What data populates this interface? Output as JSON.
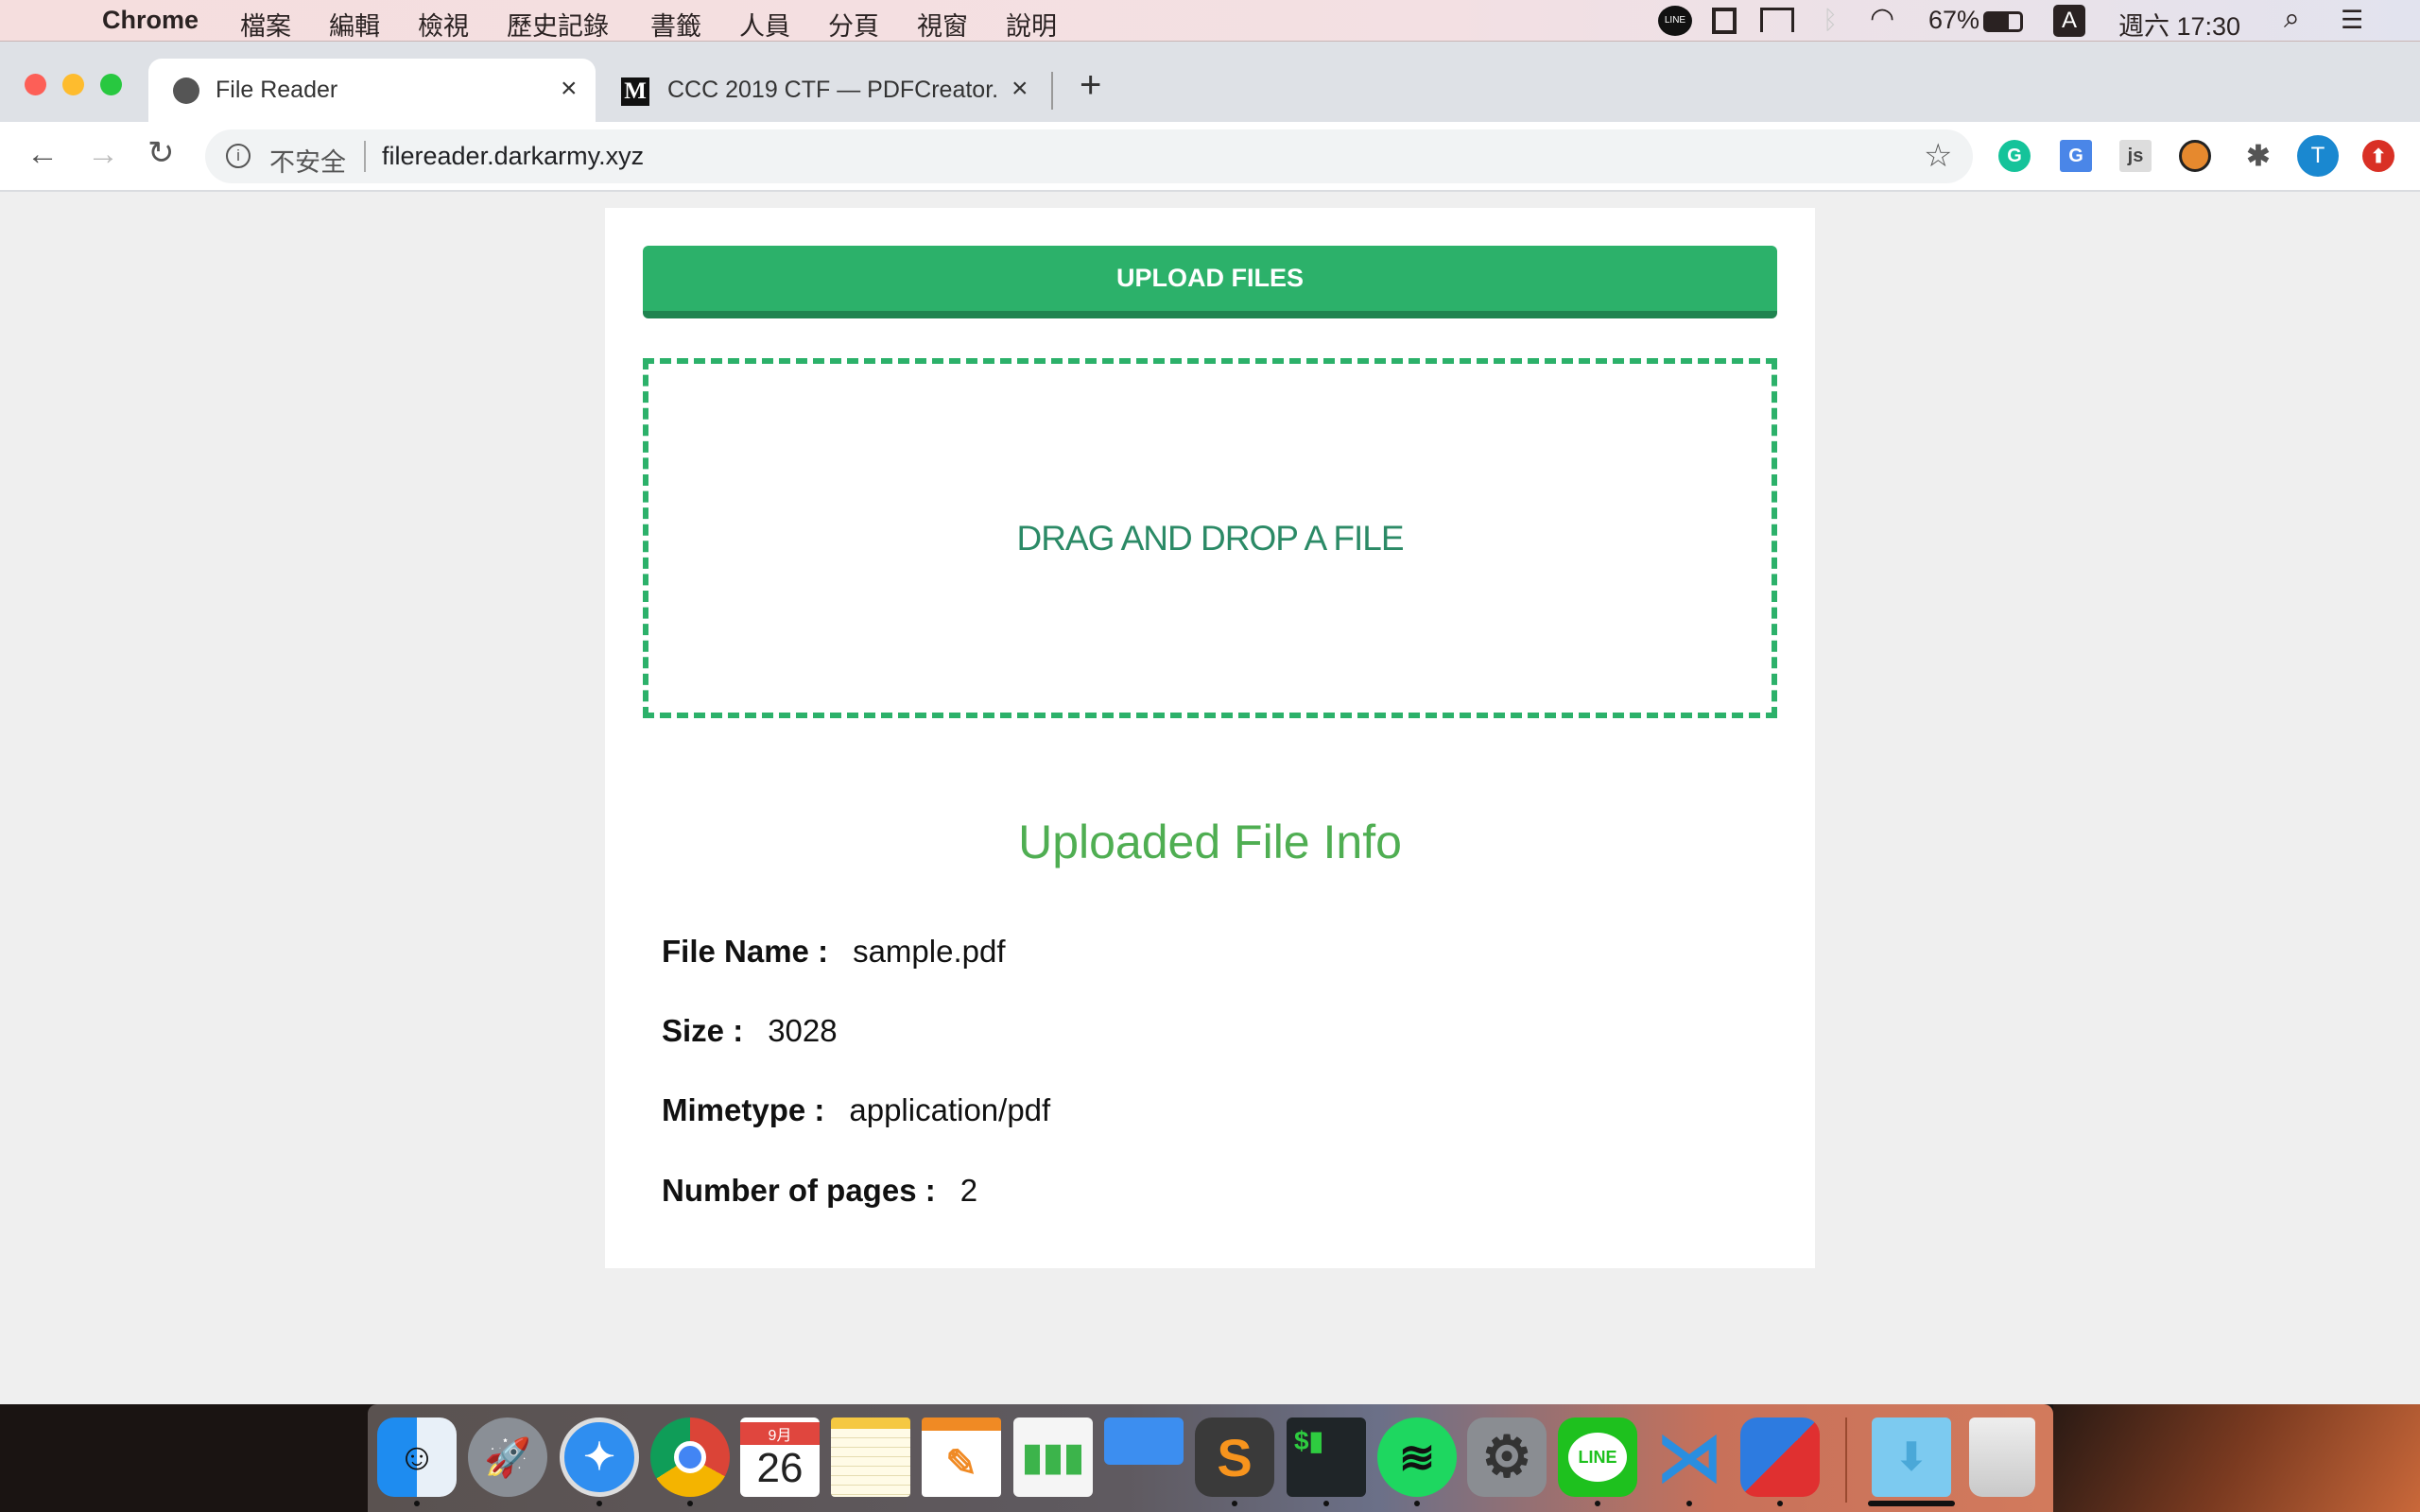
{
  "menubar": {
    "app": "Chrome",
    "items": [
      "檔案",
      "編輯",
      "檢視",
      "歷史記錄",
      "書籤",
      "人員",
      "分頁",
      "視窗",
      "說明"
    ],
    "battery": "67%",
    "input_source": "A",
    "clock": "週六 17:30",
    "status_icons": [
      "line-icon",
      "screen-mirror-icon",
      "airplay-icon",
      "bluetooth-icon",
      "wifi-icon",
      "battery-icon",
      "spotlight-icon",
      "notification-center-icon"
    ]
  },
  "tabs": [
    {
      "title": "File Reader",
      "favicon": "globe-icon",
      "active": true
    },
    {
      "title": "CCC 2019 CTF — PDFCreator.",
      "favicon": "medium-icon",
      "active": false
    }
  ],
  "toolbar": {
    "security_label": "不安全",
    "url": "filereader.darkarmy.xyz",
    "avatar_letter": "T",
    "extensions": [
      "grammarly",
      "google-translate",
      "js-toggle",
      "disabled-extension",
      "extensions-puzzle",
      "profile",
      "update"
    ]
  },
  "page": {
    "upload_label": "UPLOAD FILES",
    "drop_label": "DRAG AND DROP A FILE",
    "info_title": "Uploaded File Info",
    "fields": [
      {
        "label": "File Name :",
        "value": "sample.pdf"
      },
      {
        "label": "Size :",
        "value": "3028"
      },
      {
        "label": "Mimetype :",
        "value": "application/pdf"
      },
      {
        "label": "Number of pages :",
        "value": "2"
      }
    ],
    "accent": "#2cb16a"
  },
  "dock": {
    "apps": [
      "Finder",
      "Launchpad",
      "Safari",
      "Chrome",
      "Calendar",
      "Notes",
      "Pages",
      "Numbers",
      "Keynote",
      "Sublime Text",
      "Terminal",
      "Spotify",
      "System Preferences",
      "LINE",
      "VS Code",
      "Parallels",
      "Downloads",
      "Trash"
    ],
    "calendar_month": "9月",
    "calendar_day": "26",
    "line_label": "LINE"
  }
}
